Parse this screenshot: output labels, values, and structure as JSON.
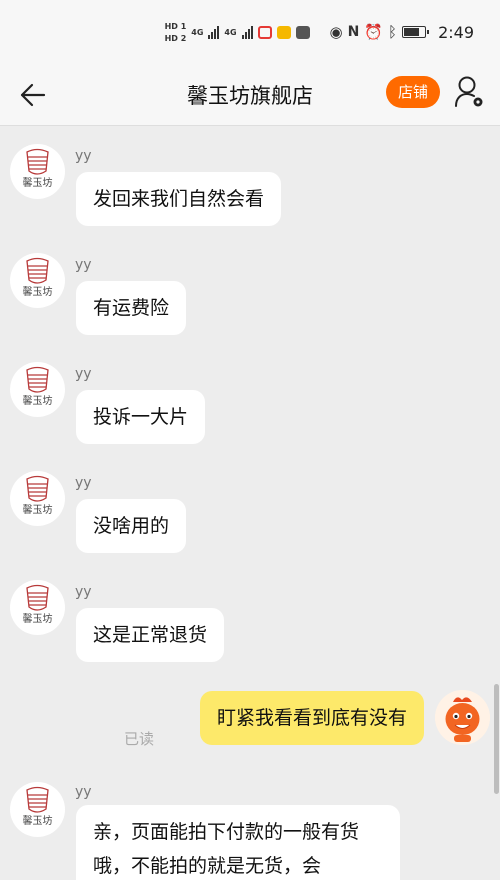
{
  "status_bar": {
    "hd1": "HD 1",
    "hd2": "HD 2",
    "net1": "4G",
    "net2": "4G",
    "time": "2:49",
    "icons": [
      "eye-icon",
      "nfc-icon",
      "alarm-icon",
      "bluetooth-icon",
      "battery-icon"
    ]
  },
  "nav": {
    "title": "馨玉坊旗舰店",
    "shop_button": "店铺",
    "back_icon": "arrow-left-icon",
    "user_icon": "user-settings-icon"
  },
  "shop_logo_text": "馨玉坊",
  "messages": [
    {
      "sender": "yy",
      "text": "发回来我们自然会看"
    },
    {
      "sender": "yy",
      "text": "有运费险"
    },
    {
      "sender": "yy",
      "text": "投诉一大片"
    },
    {
      "sender": "yy",
      "text": "没啥用的"
    },
    {
      "sender": "yy",
      "text": "这是正常退货"
    },
    {
      "self": true,
      "text": "盯紧我看看到底有没有",
      "read_label": "已读"
    },
    {
      "sender": "yy",
      "text": "亲，页面能拍下付款的一般有货哦，不能拍的就是无货，会"
    }
  ],
  "colors": {
    "accent": "#ff6a00",
    "self_bubble": "#fde96a",
    "background": "#ededed"
  }
}
